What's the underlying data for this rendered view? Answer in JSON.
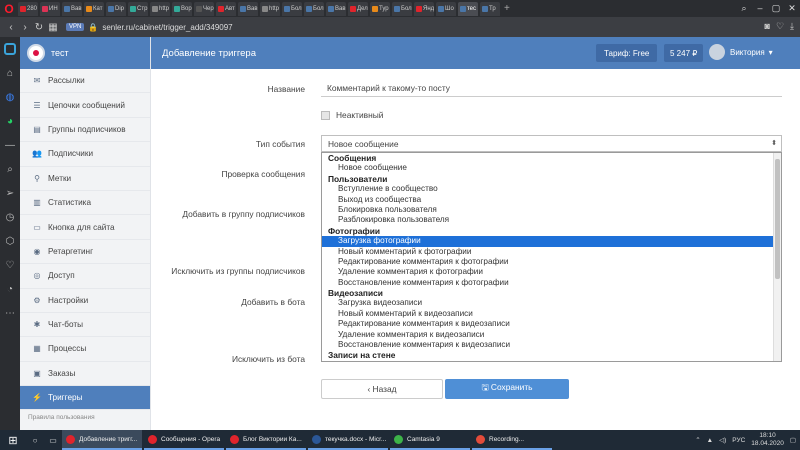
{
  "browser": {
    "tabs": [
      "280",
      "ИН",
      "Вав",
      "Кат",
      "Dip",
      "Стр",
      "http",
      "Вор",
      "Чер",
      "Авт",
      "Вав",
      "http",
      "Бол",
      "Бол",
      "Вав",
      "Дел",
      "Тур",
      "Бол",
      "Янд",
      "Шо",
      "тес",
      "Тр"
    ],
    "active_tab": "тес",
    "vpn": "VPN",
    "url": "senler.ru/cabinet/trigger_add/349097"
  },
  "sidebar": {
    "user_name": "тест",
    "items": [
      {
        "label": "Рассылки",
        "icon": "✉"
      },
      {
        "label": "Цепочки сообщений",
        "icon": "☰"
      },
      {
        "label": "Группы подписчиков",
        "icon": "▤"
      },
      {
        "label": "Подписчики",
        "icon": "👥"
      },
      {
        "label": "Метки",
        "icon": "⚲"
      },
      {
        "label": "Статистика",
        "icon": "▥"
      },
      {
        "label": "Кнопка для сайта",
        "icon": "▭"
      },
      {
        "label": "Ретаргетинг",
        "icon": "◉"
      },
      {
        "label": "Доступ",
        "icon": "◎"
      },
      {
        "label": "Настройки",
        "icon": "⚙"
      },
      {
        "label": "Чат-боты",
        "icon": "✱"
      },
      {
        "label": "Процессы",
        "icon": "▦"
      },
      {
        "label": "Заказы",
        "icon": "▣"
      },
      {
        "label": "Триггеры",
        "icon": "⚡"
      }
    ],
    "footer": "Правила пользования"
  },
  "header": {
    "title": "Добавление триггера",
    "tariff": "Тариф: Free",
    "balance": "5 247 ₽",
    "user": "Виктория"
  },
  "form": {
    "name_label": "Название",
    "name_value": "Комментарий к такому-то посту",
    "inactive_label": "Неактивный",
    "event_type_label": "Тип события",
    "event_type_value": "Новое сообщение",
    "check_message_label": "Проверка сообщения",
    "add_group_label": "Добавить в группу подписчиков",
    "exclude_group_label": "Исключить из группы подписчиков",
    "add_bot_label": "Добавить в бота",
    "exclude_bot_label": "Исключить из бота",
    "back_label": "‹ Назад",
    "save_label": "🖫 Сохранить"
  },
  "dropdown": {
    "rows": [
      {
        "type": "group",
        "label": "Сообщения"
      },
      {
        "type": "opt",
        "label": "Новое сообщение"
      },
      {
        "type": "group",
        "label": "Пользователи"
      },
      {
        "type": "opt",
        "label": "Вступление в сообщество"
      },
      {
        "type": "opt",
        "label": "Выход из сообщества"
      },
      {
        "type": "opt",
        "label": "Блокировка пользователя"
      },
      {
        "type": "opt",
        "label": "Разблокировка пользователя"
      },
      {
        "type": "group",
        "label": "Фотографии"
      },
      {
        "type": "opt",
        "label": "Загрузка фотографии",
        "selected": true
      },
      {
        "type": "opt",
        "label": "Новый комментарий к фотографии"
      },
      {
        "type": "opt",
        "label": "Редактирование комментария к фотографии"
      },
      {
        "type": "opt",
        "label": "Удаление комментария к фотографии"
      },
      {
        "type": "opt",
        "label": "Восстановление комментария к фотографии"
      },
      {
        "type": "group",
        "label": "Видеозаписи"
      },
      {
        "type": "opt",
        "label": "Загрузка видеозаписи"
      },
      {
        "type": "opt",
        "label": "Новый комментарий к видеозаписи"
      },
      {
        "type": "opt",
        "label": "Редактирование комментария к видеозаписи"
      },
      {
        "type": "opt",
        "label": "Удаление комментария к видеозаписи"
      },
      {
        "type": "opt",
        "label": "Восстановление комментария к видеозаписи"
      },
      {
        "type": "group",
        "label": "Записи на стене"
      }
    ]
  },
  "taskbar": {
    "apps": [
      {
        "label": "Добавление тригг...",
        "color": "#e0242c",
        "active": true
      },
      {
        "label": "Сообщения - Opera",
        "color": "#e0242c"
      },
      {
        "label": "Блог Виктории Ка...",
        "color": "#e0242c"
      },
      {
        "label": "текучка.docx - Micr...",
        "color": "#2b5797"
      },
      {
        "label": "Camtasia 9",
        "color": "#3db349"
      },
      {
        "label": "Recording...",
        "color": "#e34b3a"
      }
    ],
    "lang": "РУС",
    "time": "18:10",
    "date": "18.04.2020"
  },
  "colors": {
    "accent": "#4f7fbc",
    "selected": "#1e70d8"
  }
}
